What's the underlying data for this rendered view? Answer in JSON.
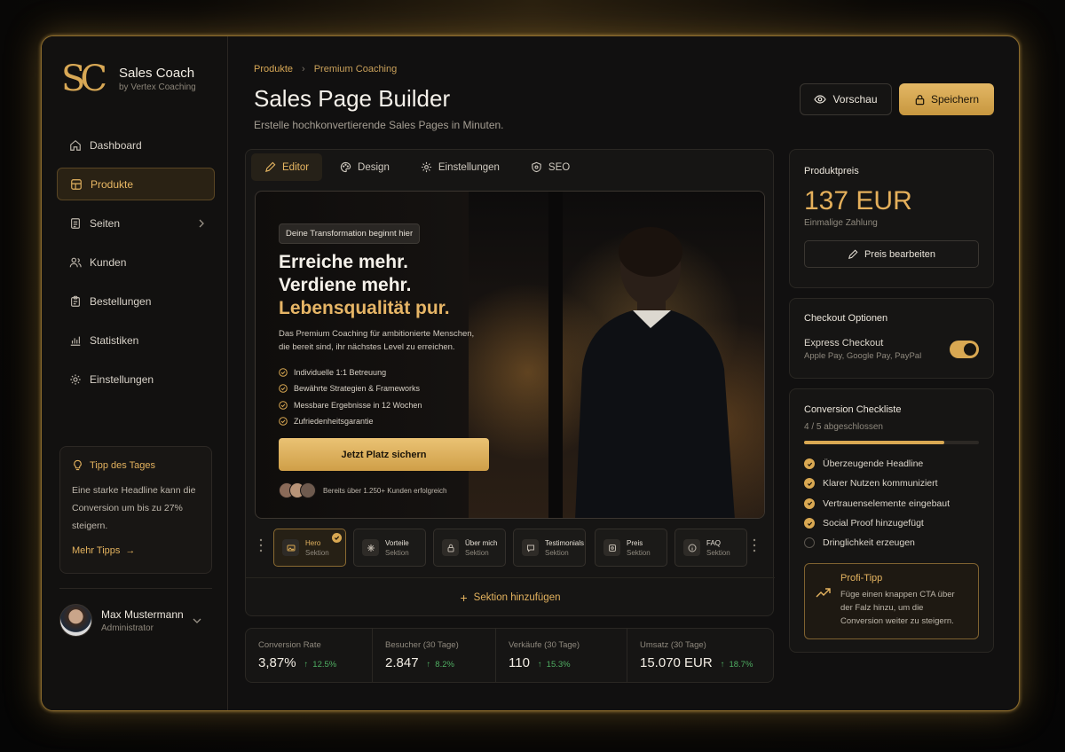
{
  "brand": {
    "logo": "SC",
    "title": "Sales Coach",
    "subtitle": "by Vertex Coaching"
  },
  "nav": [
    {
      "label": "Dashboard",
      "icon": "home-icon"
    },
    {
      "label": "Produkte",
      "icon": "box-icon",
      "active": true
    },
    {
      "label": "Seiten",
      "icon": "page-icon"
    },
    {
      "label": "Kunden",
      "icon": "users-icon"
    },
    {
      "label": "Bestellungen",
      "icon": "clipboard-icon"
    },
    {
      "label": "Statistiken",
      "icon": "chart-icon"
    },
    {
      "label": "Einstellungen",
      "icon": "gear-icon"
    }
  ],
  "tip": {
    "title": "Tipp des Tages",
    "text": "Eine starke Headline kann die Conversion um bis zu 27% steigern.",
    "link": "Mehr Tipps"
  },
  "user": {
    "name": "Max Mustermann",
    "role": "Administrator"
  },
  "breadcrumb": {
    "parent": "Produkte",
    "current": "Premium Coaching"
  },
  "page": {
    "title": "Sales Page Builder",
    "subtitle": "Erstelle hochkonvertierende Sales Pages in Minuten."
  },
  "actions": {
    "preview": "Vorschau",
    "save": "Speichern"
  },
  "tabs": [
    "Editor",
    "Design",
    "Einstellungen",
    "SEO"
  ],
  "hero": {
    "badge": "Deine Transformation beginnt hier",
    "line1": "Erreiche mehr.",
    "line2": "Verdiene mehr.",
    "line3": "Lebensqualität pur.",
    "desc": "Das Premium Coaching für ambitionierte Menschen, die bereit sind, ihr nächstes Level zu erreichen.",
    "bullets": [
      "Individuelle 1:1 Betreuung",
      "Bewährte Strategien & Frameworks",
      "Messbare Ergebnisse in 12 Wochen",
      "Zufriedenheitsgarantie"
    ],
    "cta": "Jetzt Platz sichern",
    "social": "Bereits über 1.250+ Kunden erfolgreich"
  },
  "sections": [
    {
      "title": "Hero",
      "sub": "Sektion"
    },
    {
      "title": "Vorteile",
      "sub": "Sektion"
    },
    {
      "title": "Über mich",
      "sub": "Sektion"
    },
    {
      "title": "Testimonials",
      "sub": "Sektion"
    },
    {
      "title": "Preis",
      "sub": "Sektion"
    },
    {
      "title": "FAQ",
      "sub": "Sektion"
    }
  ],
  "add_section": "Sektion hinzufügen",
  "stats": [
    {
      "label": "Conversion Rate",
      "value": "3,87%",
      "delta": "12.5%"
    },
    {
      "label": "Besucher (30 Tage)",
      "value": "2.847",
      "delta": "8.2%"
    },
    {
      "label": "Verkäufe (30 Tage)",
      "value": "110",
      "delta": "15.3%"
    },
    {
      "label": "Umsatz (30 Tage)",
      "value": "15.070 EUR",
      "delta": "18.7%"
    }
  ],
  "price": {
    "title": "Produktpreis",
    "value": "137 EUR",
    "sub": "Einmalige Zahlung",
    "edit": "Preis bearbeiten"
  },
  "checkout": {
    "title": "Checkout Optionen",
    "option": "Express Checkout",
    "option_sub": "Apple Pay, Google Pay, PayPal",
    "enabled": true
  },
  "checklist": {
    "title": "Conversion Checkliste",
    "progress_text": "4 / 5 abgeschlossen",
    "progress": 0.8,
    "items": [
      {
        "label": "Überzeugende Headline",
        "done": true
      },
      {
        "label": "Klarer Nutzen kommuniziert",
        "done": true
      },
      {
        "label": "Vertrauenselemente eingebaut",
        "done": true
      },
      {
        "label": "Social Proof hinzugefügt",
        "done": true
      },
      {
        "label": "Dringlichkeit erzeugen",
        "done": false
      }
    ]
  },
  "protip": {
    "title": "Profi-Tipp",
    "text": "Füge einen knappen CTA über der Falz hinzu, um die Conversion weiter zu steigern."
  },
  "colors": {
    "accent": "#d9a852",
    "background": "#111010",
    "positive": "#4fae62"
  }
}
